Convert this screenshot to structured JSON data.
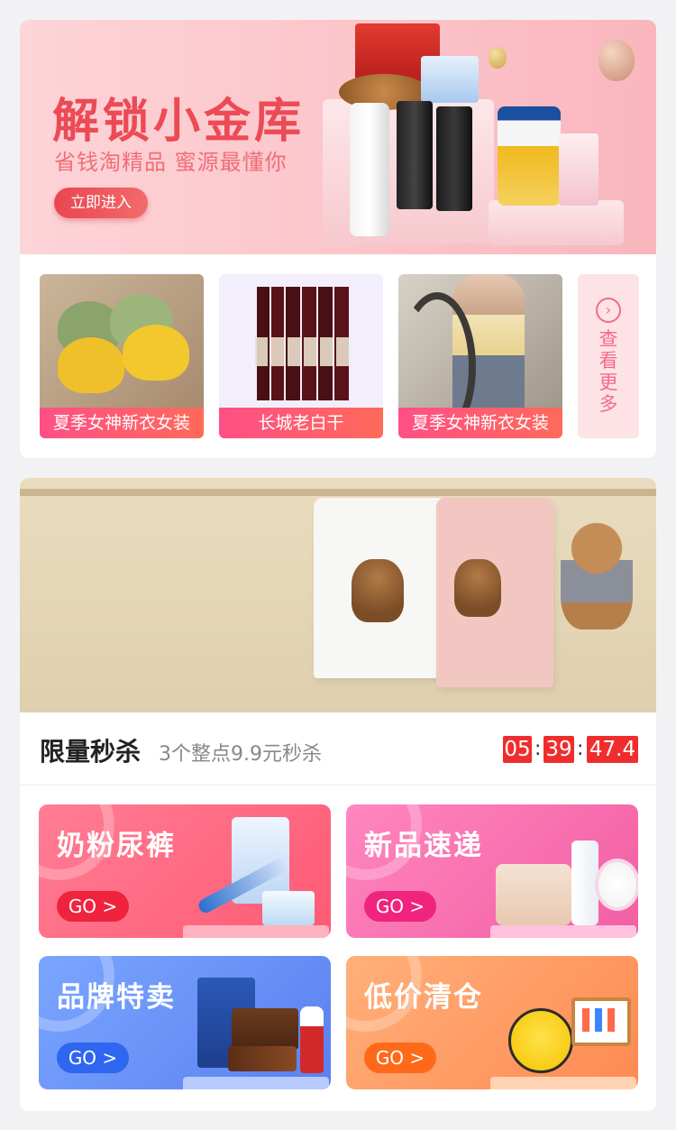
{
  "banner": {
    "title": "解锁小金库",
    "subtitle": "省钱淘精品 蜜源最懂你",
    "button_label": "立即进入"
  },
  "product_row": {
    "items": [
      {
        "label": "夏季女神新衣女装"
      },
      {
        "label": "长城老白干"
      },
      {
        "label": "夏季女神新衣女装"
      }
    ],
    "see_more_label": "查看更多"
  },
  "flash_sale": {
    "title": "限量秒杀",
    "subtitle": "3个整点9.9元秒杀",
    "countdown": {
      "hours": "05",
      "minutes": "39",
      "seconds": "47.4"
    }
  },
  "categories": [
    {
      "title": "奶粉尿裤",
      "button": "GO >"
    },
    {
      "title": "新品速递",
      "button": "GO >"
    },
    {
      "title": "品牌特卖",
      "button": "GO >"
    },
    {
      "title": "低价清仓",
      "button": "GO >"
    }
  ],
  "colors": {
    "accent_red": "#f02d2d",
    "banner_pink": "#fbc3c8",
    "label_gradient_start": "#ff4f86"
  }
}
